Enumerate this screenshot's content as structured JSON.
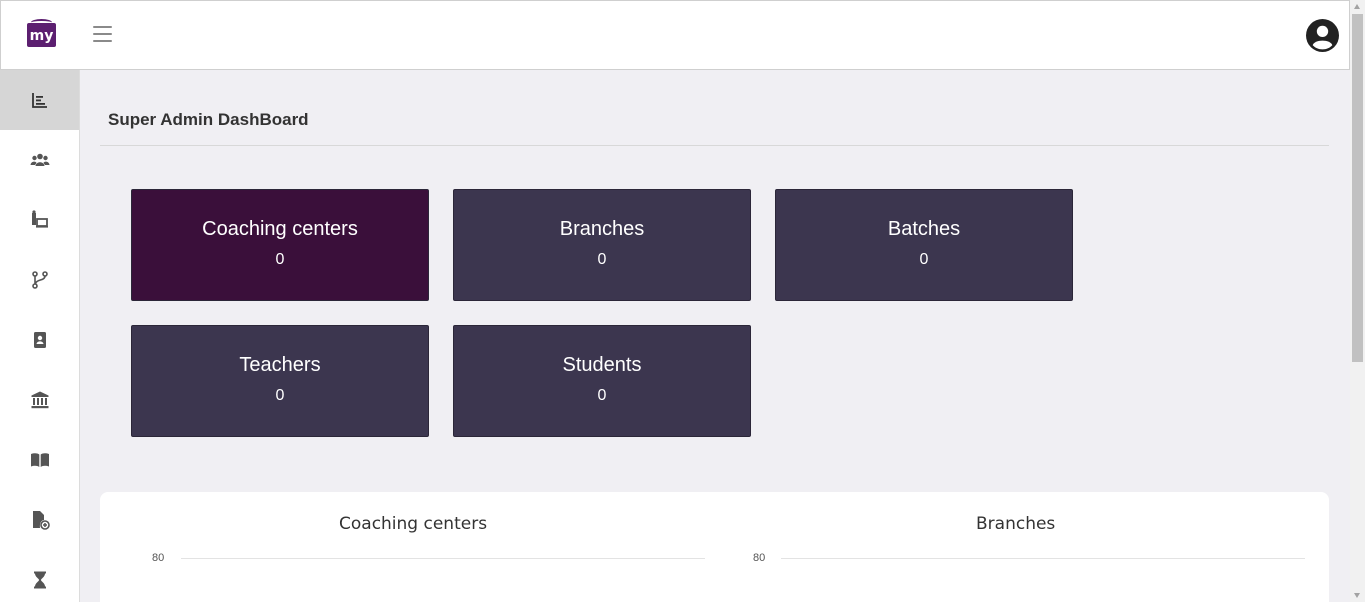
{
  "header": {
    "logo_text": "my",
    "menu_icon": "hamburger-icon",
    "profile_icon": "user-circle-icon"
  },
  "sidebar": {
    "items": [
      {
        "icon": "chart-bar-icon",
        "active": true
      },
      {
        "icon": "users-icon",
        "active": false
      },
      {
        "icon": "classroom-icon",
        "active": false
      },
      {
        "icon": "branch-icon",
        "active": false
      },
      {
        "icon": "contact-book-icon",
        "active": false
      },
      {
        "icon": "institution-icon",
        "active": false
      },
      {
        "icon": "open-book-icon",
        "active": false
      },
      {
        "icon": "file-add-icon",
        "active": false
      },
      {
        "icon": "hourglass-icon",
        "active": false
      }
    ]
  },
  "main": {
    "title": "Super Admin DashBoard",
    "cards": [
      {
        "label": "Coaching centers",
        "value": "0"
      },
      {
        "label": "Branches",
        "value": "0"
      },
      {
        "label": "Batches",
        "value": "0"
      },
      {
        "label": "Teachers",
        "value": "0"
      },
      {
        "label": "Students",
        "value": "0"
      }
    ]
  },
  "chart_data": [
    {
      "type": "bar",
      "title": "Coaching centers",
      "y_ticks": [
        "80"
      ]
    },
    {
      "type": "bar",
      "title": "Branches",
      "y_ticks": [
        "80"
      ]
    }
  ],
  "colors": {
    "brand": "#5c1f70",
    "card": "#3c364f",
    "card_highlight": "#3a0f3a",
    "background": "#f0eff3"
  }
}
